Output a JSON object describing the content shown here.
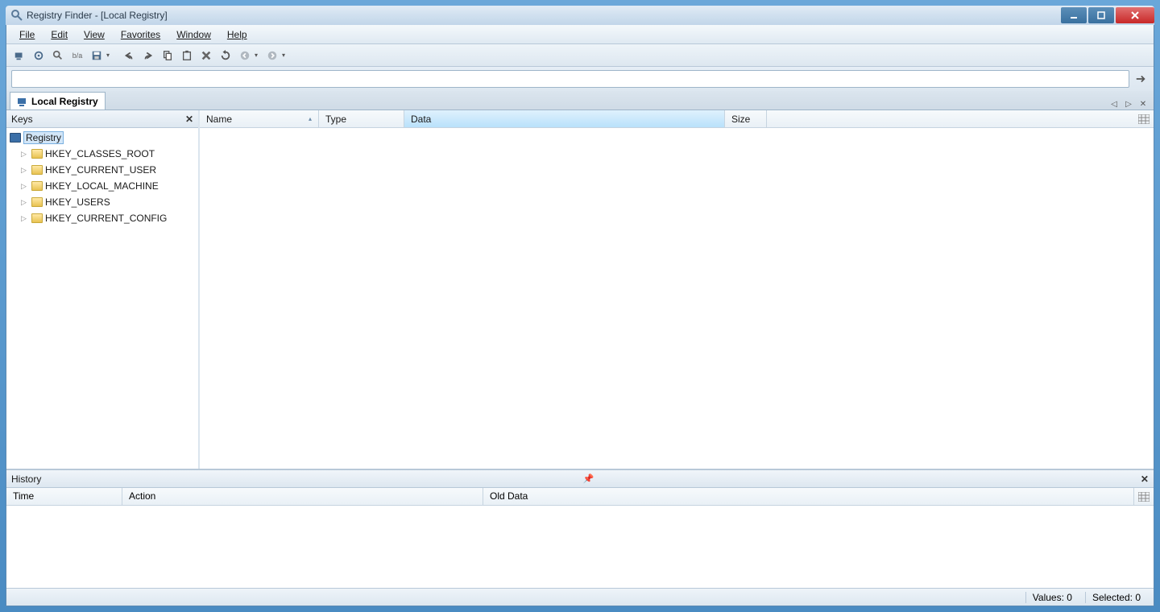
{
  "window": {
    "title": "Registry Finder - [Local Registry]"
  },
  "menu": {
    "file": "File",
    "edit": "Edit",
    "view": "View",
    "favorites": "Favorites",
    "window": "Window",
    "help": "Help"
  },
  "tab": {
    "label": "Local Registry"
  },
  "keys_panel": {
    "title": "Keys",
    "root": "Registry",
    "items": [
      "HKEY_CLASSES_ROOT",
      "HKEY_CURRENT_USER",
      "HKEY_LOCAL_MACHINE",
      "HKEY_USERS",
      "HKEY_CURRENT_CONFIG"
    ]
  },
  "columns": {
    "name": "Name",
    "type": "Type",
    "data": "Data",
    "size": "Size"
  },
  "history": {
    "title": "History",
    "cols": {
      "time": "Time",
      "action": "Action",
      "olddata": "Old Data"
    }
  },
  "status": {
    "values": "Values: 0",
    "selected": "Selected: 0"
  },
  "address": {
    "value": ""
  }
}
